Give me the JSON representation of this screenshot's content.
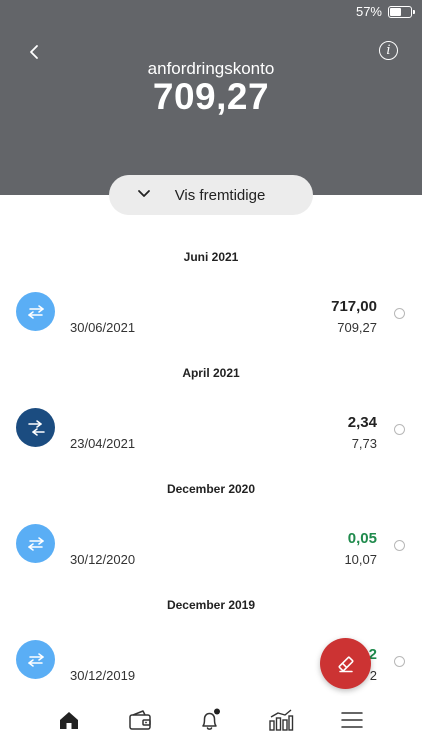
{
  "status": {
    "battery_percent": "57%",
    "battery_level": 0.57
  },
  "header": {
    "account_name": "anfordringskonto",
    "balance": "709,27",
    "back_icon": "chevron-left-icon",
    "info_icon": "info-icon",
    "background": "#636569"
  },
  "future_button": {
    "label": "Vis fremtidige",
    "icon": "chevron-down-icon"
  },
  "sections": [
    {
      "month": "Juni 2021",
      "date": "30/06/2021",
      "amount": "717,00",
      "balance": "709,27",
      "amount_color": "#222222",
      "icon_variant": "light",
      "icon": "transfer-icon"
    },
    {
      "month": "April 2021",
      "date": "23/04/2021",
      "amount": "2,34",
      "balance": "7,73",
      "amount_color": "#222222",
      "icon_variant": "dark",
      "icon": "transfer-in-icon"
    },
    {
      "month": "December 2020",
      "date": "30/12/2020",
      "amount": "0,05",
      "balance": "10,07",
      "amount_color": "#1f8a4c",
      "icon_variant": "light",
      "icon": "transfer-icon"
    },
    {
      "month": "December 2019",
      "date": "30/12/2019",
      "amount": "2",
      "balance": "2",
      "amount_color": "#1f8a4c",
      "icon_variant": "light",
      "icon": "transfer-icon"
    }
  ],
  "fab": {
    "icon": "eraser-icon",
    "color": "#cc3333"
  },
  "tabbar": [
    {
      "name": "home",
      "icon": "home-icon",
      "active": true
    },
    {
      "name": "wallet",
      "icon": "wallet-icon",
      "active": false
    },
    {
      "name": "notifications",
      "icon": "bell-icon",
      "active": false,
      "badge": true
    },
    {
      "name": "analytics",
      "icon": "bar-chart-icon",
      "active": false
    },
    {
      "name": "menu",
      "icon": "menu-icon",
      "active": false
    }
  ],
  "colors": {
    "icon_light": "#5aaef5",
    "icon_dark": "#1b4c80"
  }
}
